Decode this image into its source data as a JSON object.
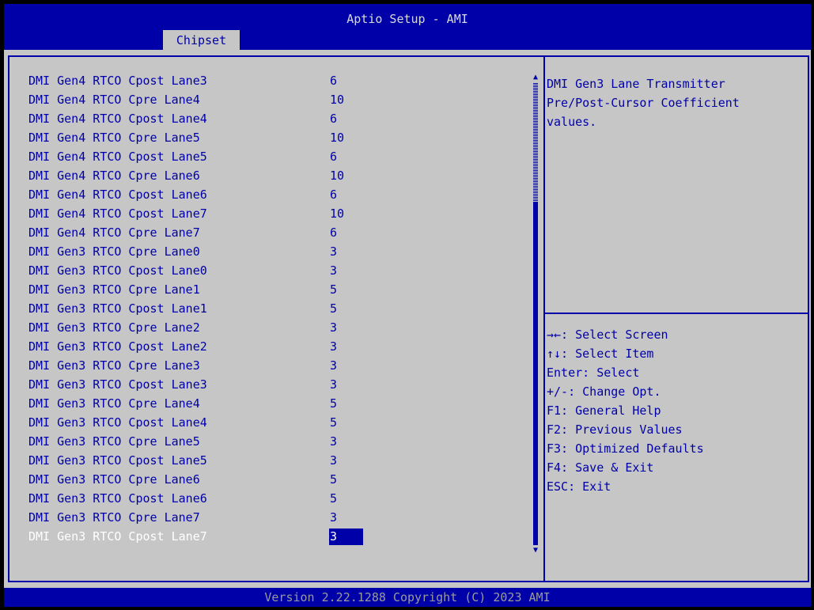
{
  "header": {
    "title": "Aptio Setup - AMI",
    "tab": "Chipset"
  },
  "settings": [
    {
      "label": "DMI Gen4 RTCO Cpost Lane3",
      "value": "6"
    },
    {
      "label": "DMI Gen4 RTCO Cpre Lane4",
      "value": "10"
    },
    {
      "label": "DMI Gen4 RTCO Cpost Lane4",
      "value": "6"
    },
    {
      "label": "DMI Gen4 RTCO Cpre Lane5",
      "value": "10"
    },
    {
      "label": "DMI Gen4 RTCO Cpost Lane5",
      "value": "6"
    },
    {
      "label": "DMI Gen4 RTCO Cpre Lane6",
      "value": "10"
    },
    {
      "label": "DMI Gen4 RTCO Cpost Lane6",
      "value": "6"
    },
    {
      "label": "DMI Gen4 RTCO Cpost Lane7",
      "value": "10"
    },
    {
      "label": "DMI Gen4 RTCO Cpre Lane7",
      "value": "6"
    },
    {
      "label": "DMI Gen3 RTCO Cpre Lane0",
      "value": "3"
    },
    {
      "label": "DMI Gen3 RTCO Cpost Lane0",
      "value": "3"
    },
    {
      "label": "DMI Gen3 RTCO Cpre Lane1",
      "value": "5"
    },
    {
      "label": "DMI Gen3 RTCO Cpost Lane1",
      "value": "5"
    },
    {
      "label": "DMI Gen3 RTCO Cpre Lane2",
      "value": "3"
    },
    {
      "label": "DMI Gen3 RTCO Cpost Lane2",
      "value": "3"
    },
    {
      "label": "DMI Gen3 RTCO Cpre Lane3",
      "value": "3"
    },
    {
      "label": "DMI Gen3 RTCO Cpost Lane3",
      "value": "3"
    },
    {
      "label": "DMI Gen3 RTCO Cpre Lane4",
      "value": "5"
    },
    {
      "label": "DMI Gen3 RTCO Cpost Lane4",
      "value": "5"
    },
    {
      "label": "DMI Gen3 RTCO Cpre Lane5",
      "value": "3"
    },
    {
      "label": "DMI Gen3 RTCO Cpost Lane5",
      "value": "3"
    },
    {
      "label": "DMI Gen3 RTCO Cpre Lane6",
      "value": "5"
    },
    {
      "label": "DMI Gen3 RTCO Cpost Lane6",
      "value": "5"
    },
    {
      "label": "DMI Gen3 RTCO Cpre Lane7",
      "value": "3"
    },
    {
      "label": "DMI Gen3 RTCO Cpost Lane7",
      "value": "3"
    }
  ],
  "selected_index": 24,
  "help": {
    "lines": [
      "DMI Gen3 Lane Transmitter",
      "Pre/Post-Cursor Coefficient",
      "values."
    ]
  },
  "keys": [
    "→←: Select Screen",
    "↑↓: Select Item",
    "Enter: Select",
    "+/-: Change Opt.",
    "F1: General Help",
    "F2: Previous Values",
    "F3: Optimized Defaults",
    "F4: Save & Exit",
    "ESC: Exit"
  ],
  "scrollbar": {
    "up_icon": "▲",
    "down_icon": "▼"
  },
  "footer": {
    "text": "Version 2.22.1288 Copyright (C) 2023 AMI"
  },
  "colors": {
    "bios_blue": "#0000a8",
    "panel_gray": "#c6c6c6",
    "highlight_text": "#ffffff"
  }
}
